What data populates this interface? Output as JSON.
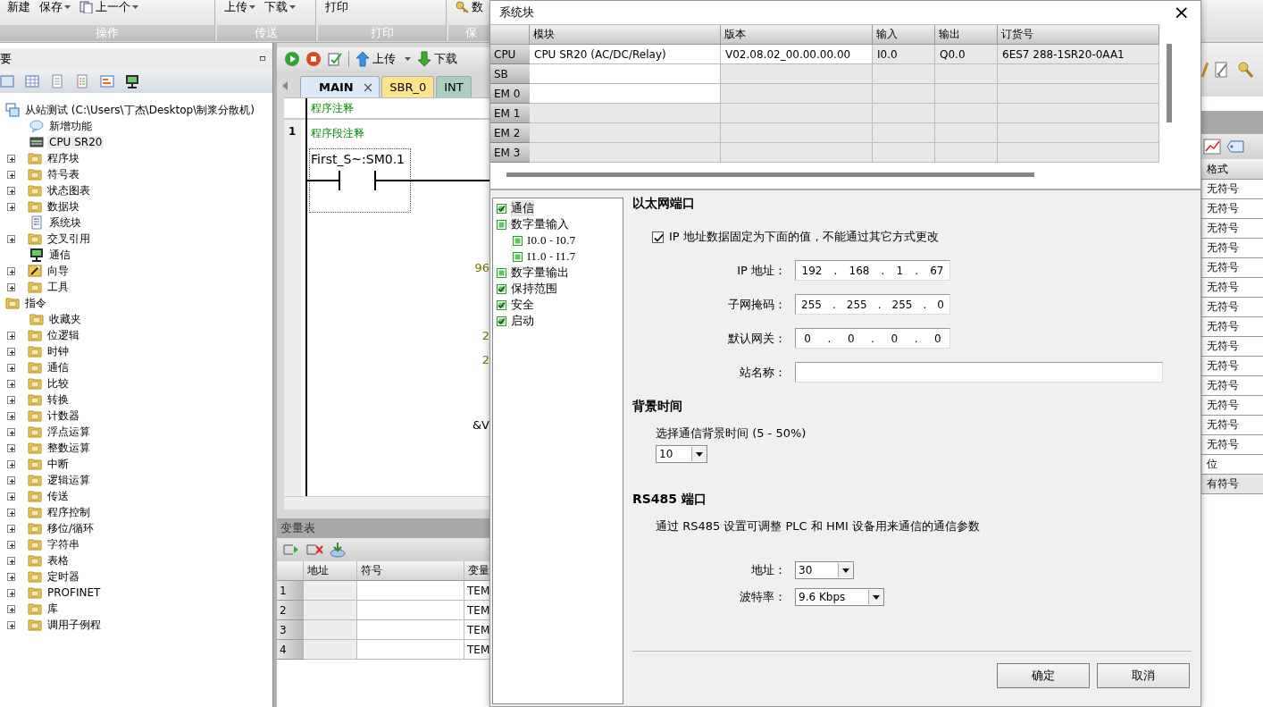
{
  "ribbon": {
    "groups": [
      {
        "label": "操作",
        "items": [
          {
            "label": "新建",
            "caret": false,
            "kind": "text"
          },
          {
            "label": "保存",
            "caret": true,
            "kind": "text"
          },
          {
            "label": "上一个",
            "caret": true,
            "kind": "previous"
          }
        ]
      },
      {
        "label": "传送",
        "items": [
          {
            "label": "上传",
            "caret": true,
            "kind": "text"
          },
          {
            "label": "下载",
            "caret": true,
            "kind": "text"
          }
        ]
      },
      {
        "label": "打印",
        "items": [
          {
            "label": "打印",
            "caret": false,
            "kind": "text"
          }
        ]
      },
      {
        "label": "保",
        "items": [
          {
            "label": "数",
            "caret": false,
            "kind": "key"
          }
        ]
      }
    ]
  },
  "left_panel": {
    "title": "要",
    "pin": "ㅁ",
    "tree": [
      {
        "label": "从站测试 (C:\\Users\\丁杰\\Desktop\\制浆分散机)",
        "kind": "project",
        "selected": false,
        "children": [
          {
            "label": "新增功能",
            "kind": "help",
            "selected": false
          },
          {
            "label": "CPU SR20",
            "kind": "device",
            "selected": true
          },
          {
            "label": "程序块",
            "kind": "folder",
            "selected": false,
            "expanded": false
          },
          {
            "label": "符号表",
            "kind": "folder",
            "selected": false,
            "expanded": false
          },
          {
            "label": "状态图表",
            "kind": "folder",
            "selected": false,
            "expanded": false
          },
          {
            "label": "数据块",
            "kind": "folder",
            "selected": false,
            "expanded": false
          },
          {
            "label": "系统块",
            "kind": "document",
            "selected": false
          },
          {
            "label": "交叉引用",
            "kind": "folder",
            "selected": false,
            "expanded": false
          },
          {
            "label": "通信",
            "kind": "monitor",
            "selected": false
          },
          {
            "label": "向导",
            "kind": "wand",
            "selected": false,
            "expanded": false
          },
          {
            "label": "工具",
            "kind": "folder",
            "selected": false,
            "expanded": false
          }
        ]
      },
      {
        "label": "指令",
        "kind": "folder",
        "selected": false,
        "children": [
          {
            "label": "收藏夹",
            "kind": "folder",
            "selected": false
          },
          {
            "label": "位逻辑",
            "kind": "folder",
            "selected": false,
            "expanded": false
          },
          {
            "label": "时钟",
            "kind": "folder",
            "selected": false,
            "expanded": false
          },
          {
            "label": "通信",
            "kind": "folder",
            "selected": false,
            "expanded": false
          },
          {
            "label": "比较",
            "kind": "folder",
            "selected": false,
            "expanded": false
          },
          {
            "label": "转换",
            "kind": "folder",
            "selected": false,
            "expanded": false
          },
          {
            "label": "计数器",
            "kind": "folder",
            "selected": false,
            "expanded": false
          },
          {
            "label": "浮点运算",
            "kind": "folder",
            "selected": false,
            "expanded": false
          },
          {
            "label": "整数运算",
            "kind": "folder",
            "selected": false,
            "expanded": false
          },
          {
            "label": "中断",
            "kind": "folder",
            "selected": false,
            "expanded": false
          },
          {
            "label": "逻辑运算",
            "kind": "folder",
            "selected": false,
            "expanded": false
          },
          {
            "label": "传送",
            "kind": "folder",
            "selected": false,
            "expanded": false
          },
          {
            "label": "程序控制",
            "kind": "folder",
            "selected": false,
            "expanded": false
          },
          {
            "label": "移位/循环",
            "kind": "folder",
            "selected": false,
            "expanded": false
          },
          {
            "label": "字符串",
            "kind": "folder",
            "selected": false,
            "expanded": false
          },
          {
            "label": "表格",
            "kind": "folder",
            "selected": false,
            "expanded": false
          },
          {
            "label": "定时器",
            "kind": "folder",
            "selected": false,
            "expanded": false
          },
          {
            "label": "PROFINET",
            "kind": "folder",
            "selected": false,
            "expanded": false
          },
          {
            "label": "库",
            "kind": "folder",
            "selected": false,
            "expanded": false
          },
          {
            "label": "调用子例程",
            "kind": "folder",
            "selected": false,
            "expanded": false
          }
        ]
      }
    ]
  },
  "editor": {
    "toolbar": [
      {
        "kind": "run"
      },
      {
        "kind": "stop"
      },
      {
        "kind": "compile"
      },
      {
        "kind": "upload",
        "label": "上传",
        "caret": true
      },
      {
        "kind": "download",
        "label": "下载",
        "caret": false
      }
    ],
    "tabs": [
      {
        "label": "MAIN",
        "close": "×",
        "selected": true,
        "color": "#dce9f8"
      },
      {
        "label": "SBR_0",
        "selected": false,
        "color": "#fde38a"
      },
      {
        "label": "INT",
        "selected": false,
        "color": "#a9cfc0"
      }
    ],
    "program_comment": "程序注释",
    "networks": [
      {
        "number": "1",
        "comment": "程序段注释",
        "contact": "First_S~:SM0.1"
      }
    ],
    "fragments": [
      {
        "text": "96",
        "kind": "value"
      },
      {
        "text": "2",
        "kind": "value"
      },
      {
        "text": "2",
        "kind": "value"
      },
      {
        "text": "&V",
        "kind": "operand"
      }
    ]
  },
  "variable_table": {
    "title": "变量表",
    "columns": [
      "地址",
      "符号",
      "变量"
    ],
    "rows": [
      {
        "number": "1",
        "type": "TEM"
      },
      {
        "number": "2",
        "type": "TEM"
      },
      {
        "number": "3",
        "type": "TEM"
      },
      {
        "number": "4",
        "type": "TEM"
      }
    ]
  },
  "right_panel": {
    "column": "格式",
    "rows": [
      {
        "text": "无符号",
        "selected": false
      },
      {
        "text": "无符号",
        "selected": false
      },
      {
        "text": "无符号",
        "selected": false
      },
      {
        "text": "无符号",
        "selected": false
      },
      {
        "text": "无符号",
        "selected": false
      },
      {
        "text": "无符号",
        "selected": false
      },
      {
        "text": "无符号",
        "selected": false
      },
      {
        "text": "无符号",
        "selected": false
      },
      {
        "text": "无符号",
        "selected": false
      },
      {
        "text": "无符号",
        "selected": false
      },
      {
        "text": "无符号",
        "selected": false
      },
      {
        "text": "无符号",
        "selected": false
      },
      {
        "text": "无符号",
        "selected": false
      },
      {
        "text": "无符号",
        "selected": false
      },
      {
        "text": "位",
        "selected": false
      },
      {
        "text": "有符号",
        "selected": true
      }
    ]
  },
  "dialog": {
    "title": "系统块",
    "close": "×",
    "table": {
      "columns": [
        "模块",
        "版本",
        "输入",
        "输出",
        "订货号"
      ],
      "rows": [
        {
          "header": "CPU",
          "cells": [
            {
              "text": "CPU SR20 (AC/DC/Relay)",
              "enabled": true
            },
            {
              "text": "V02.08.02_00.00.00.00",
              "enabled": true
            },
            {
              "text": "I0.0",
              "enabled": false
            },
            {
              "text": "Q0.0",
              "enabled": false
            },
            {
              "text": "6ES7 288-1SR20-0AA1",
              "enabled": false
            }
          ]
        },
        {
          "header": "SB",
          "cells": [
            {
              "enabled": true
            },
            {
              "enabled": false
            },
            {
              "enabled": false
            },
            {
              "enabled": false
            },
            {
              "enabled": false
            }
          ]
        },
        {
          "header": "EM 0",
          "cells": [
            {
              "enabled": true
            },
            {
              "enabled": false
            },
            {
              "enabled": false
            },
            {
              "enabled": false
            },
            {
              "enabled": false
            }
          ]
        },
        {
          "header": "EM 1",
          "cells": [
            {
              "enabled": false
            },
            {
              "enabled": false
            },
            {
              "enabled": false
            },
            {
              "enabled": false
            },
            {
              "enabled": false
            }
          ]
        },
        {
          "header": "EM 2",
          "cells": [
            {
              "enabled": false
            },
            {
              "enabled": false
            },
            {
              "enabled": false
            },
            {
              "enabled": false
            },
            {
              "enabled": false
            }
          ]
        },
        {
          "header": "EM 3",
          "cells": [
            {
              "enabled": false
            },
            {
              "enabled": false
            },
            {
              "enabled": false
            },
            {
              "enabled": false
            },
            {
              "enabled": false
            }
          ]
        }
      ]
    },
    "tree": [
      {
        "label": "通信",
        "checked": true,
        "selected": true
      },
      {
        "label": "数字量输入",
        "checked": false,
        "selected": false,
        "children": [
          {
            "label": "I0.0 - I0.7",
            "checked": false,
            "selected": false
          },
          {
            "label": "I1.0 - I1.7",
            "checked": false,
            "selected": false
          }
        ]
      },
      {
        "label": "数字量输出",
        "checked": false,
        "selected": false
      },
      {
        "label": "保持范围",
        "checked": true,
        "selected": false
      },
      {
        "label": "安全",
        "checked": true,
        "selected": false
      },
      {
        "label": "启动",
        "checked": true,
        "selected": false
      }
    ],
    "ethernet": {
      "heading": "以太网端口",
      "fixed_ip": {
        "label": "IP 地址数据固定为下面的值，不能通过其它方式更改",
        "checked": true
      },
      "fields": [
        {
          "label": "IP 地址：",
          "parts": [
            "192",
            ".",
            "168",
            ".",
            "1",
            ".",
            "67"
          ]
        },
        {
          "label": "子网掩码：",
          "parts": [
            "255",
            ".",
            "255",
            ".",
            "255",
            ".",
            "0"
          ]
        },
        {
          "label": "默认网关：",
          "parts": [
            "0",
            ".",
            "0",
            ".",
            "0",
            ".",
            "0"
          ]
        },
        {
          "label": "站名称："
        }
      ]
    },
    "background": {
      "heading": "背景时间",
      "text": "选择通信背景时间 (5 - 50%)",
      "value": "10"
    },
    "rs485": {
      "heading": "RS485 端口",
      "text": "通过 RS485 设置可调整 PLC 和 HMI 设备用来通信的通信参数",
      "fields": [
        {
          "label": "地址：",
          "value": "30"
        },
        {
          "label": "波特率：",
          "value": "9.6 Kbps"
        }
      ]
    },
    "buttons": [
      "确定",
      "取消"
    ]
  }
}
